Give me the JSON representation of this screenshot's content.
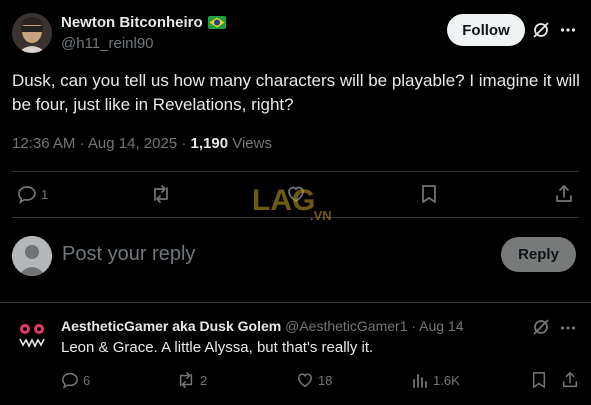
{
  "post": {
    "author_name": "Newton Bitconheiro",
    "handle": "@h11_reinl90",
    "follow_label": "Follow",
    "text": "Dusk, can you tell us how many characters will be playable? I imagine it will be four, just like in Revelations, right?",
    "time": "12:36 AM",
    "date": "Aug 14, 2025",
    "views_count": "1,190",
    "views_label": "Views",
    "reply_count": "1"
  },
  "composer": {
    "placeholder": "Post your reply",
    "reply_label": "Reply"
  },
  "reply": {
    "author_name": "AestheticGamer aka Dusk Golem",
    "handle": "@AestheticGamer1",
    "date": "Aug 14",
    "text": "Leon & Grace. A little Alyssa, but that's really it.",
    "replies": "6",
    "reposts": "2",
    "likes": "18",
    "views": "1.6K"
  },
  "watermark": {
    "text": "LAG",
    "suffix": ".VN"
  },
  "colors": {
    "background": "#000000",
    "text": "#e7e9ea",
    "muted": "#71767b",
    "divider": "#2f3336"
  }
}
